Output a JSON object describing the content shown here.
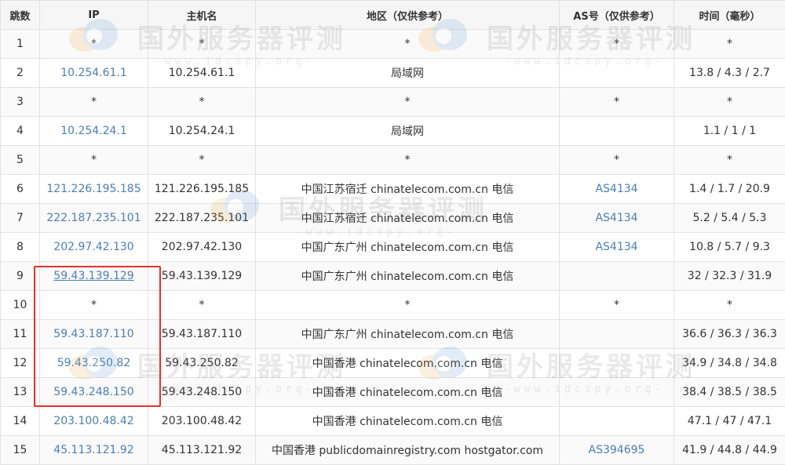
{
  "columns": [
    "跳数",
    "IP",
    "主机名",
    "地区（仅供参考）",
    "AS号（仅供参考）",
    "时间（毫秒）"
  ],
  "rows": [
    {
      "hop": "1",
      "ip": "*",
      "host": "*",
      "region": "*",
      "as": "*",
      "time": "*"
    },
    {
      "hop": "2",
      "ip": "10.254.61.1",
      "host": "10.254.61.1",
      "region": "局域网",
      "as": "",
      "time": "13.8 / 4.3 / 2.7"
    },
    {
      "hop": "3",
      "ip": "*",
      "host": "*",
      "region": "*",
      "as": "*",
      "time": "*"
    },
    {
      "hop": "4",
      "ip": "10.254.24.1",
      "host": "10.254.24.1",
      "region": "局域网",
      "as": "",
      "time": "1.1 / 1 / 1"
    },
    {
      "hop": "5",
      "ip": "*",
      "host": "*",
      "region": "*",
      "as": "*",
      "time": "*"
    },
    {
      "hop": "6",
      "ip": "121.226.195.185",
      "host": "121.226.195.185",
      "region": "中国江苏宿迁 chinatelecom.com.cn 电信",
      "as": "AS4134",
      "time": "1.4 / 1.7 / 20.9"
    },
    {
      "hop": "7",
      "ip": "222.187.235.101",
      "host": "222.187.235.101",
      "region": "中国江苏宿迁 chinatelecom.com.cn 电信",
      "as": "AS4134",
      "time": "5.2 / 5.4 / 5.3"
    },
    {
      "hop": "8",
      "ip": "202.97.42.130",
      "host": "202.97.42.130",
      "region": "中国广东广州 chinatelecom.com.cn 电信",
      "as": "AS4134",
      "time": "10.8 / 5.7 / 9.3"
    },
    {
      "hop": "9",
      "ip": "59.43.139.129",
      "host": "59.43.139.129",
      "region": "中国广东广州 chinatelecom.com.cn 电信",
      "as": "",
      "time": "32 / 32.3 / 31.9"
    },
    {
      "hop": "10",
      "ip": "*",
      "host": "*",
      "region": "*",
      "as": "*",
      "time": "*"
    },
    {
      "hop": "11",
      "ip": "59.43.187.110",
      "host": "59.43.187.110",
      "region": "中国广东广州 chinatelecom.com.cn 电信",
      "as": "",
      "time": "36.6 / 36.3 / 36.3"
    },
    {
      "hop": "12",
      "ip": "59.43.250.82",
      "host": "59.43.250.82",
      "region": "中国香港 chinatelecom.com.cn 电信",
      "as": "",
      "time": "34.9 / 34.8 / 34.8"
    },
    {
      "hop": "13",
      "ip": "59.43.248.150",
      "host": "59.43.248.150",
      "region": "中国香港 chinatelecom.com.cn 电信",
      "as": "",
      "time": "38.4 / 38.5 / 38.5"
    },
    {
      "hop": "14",
      "ip": "203.100.48.42",
      "host": "203.100.48.42",
      "region": "中国香港 chinatelecom.com.cn 电信",
      "as": "",
      "time": "47.1 / 47 / 47.1"
    },
    {
      "hop": "15",
      "ip": "45.113.121.92",
      "host": "45.113.121.92",
      "region": "中国香港 publicdomainregistry.com hostgator.com",
      "as": "AS394695",
      "time": "41.9 / 44.8 / 44.9"
    }
  ],
  "watermark": {
    "title": "国外服务器评测",
    "sub": "-www.idcspy.org-"
  },
  "colors": {
    "link": "#4a7fb8",
    "highlight": "#e8302a",
    "header_bg": "#f6f6f6",
    "border": "#e2e2e2"
  }
}
